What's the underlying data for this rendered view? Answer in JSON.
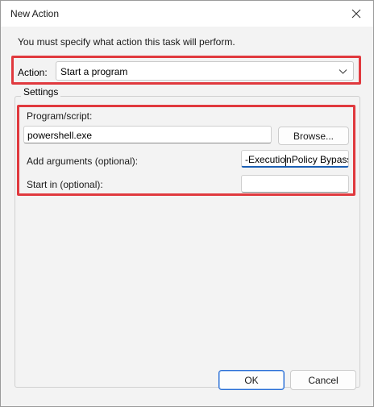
{
  "window": {
    "title": "New Action"
  },
  "instruction": "You must specify what action this task will perform.",
  "action": {
    "label": "Action:",
    "value": "Start a program"
  },
  "settings": {
    "legend": "Settings",
    "program_label": "Program/script:",
    "program_value": "powershell.exe",
    "browse_label": "Browse...",
    "arguments_label": "Add arguments (optional):",
    "arguments_value_before_caret": "-Executio",
    "arguments_value_after_caret": "nPolicy Bypass",
    "startin_label": "Start in (optional):",
    "startin_value": ""
  },
  "buttons": {
    "ok": "OK",
    "cancel": "Cancel"
  },
  "colors": {
    "highlight": "#e0393e",
    "focus_accent": "#1a5fb4"
  }
}
